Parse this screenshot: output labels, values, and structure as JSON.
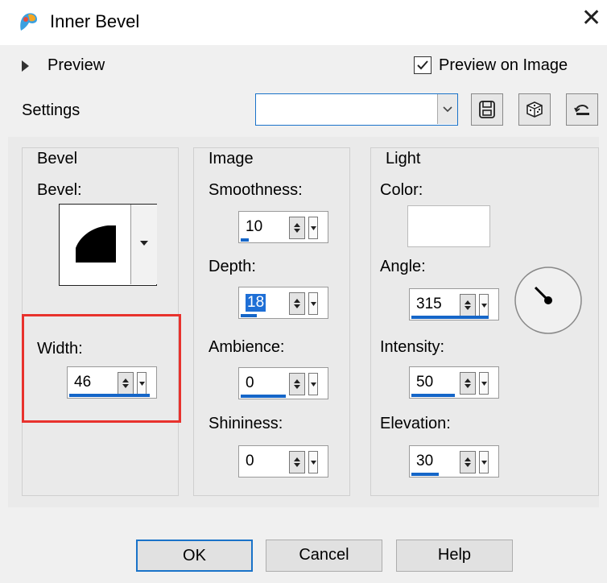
{
  "window": {
    "title": "Inner Bevel"
  },
  "preview": {
    "toggle_label": "Preview",
    "on_image_label": "Preview on Image",
    "on_image_checked": true
  },
  "settings": {
    "label": "Settings",
    "preset_value": ""
  },
  "bevel_group": {
    "title": "Bevel",
    "bevel_label": "Bevel:",
    "width_label": "Width:",
    "width_value": "46"
  },
  "image_group": {
    "title": "Image",
    "smoothness_label": "Smoothness:",
    "smoothness_value": "10",
    "depth_label": "Depth:",
    "depth_value": "18",
    "ambience_label": "Ambience:",
    "ambience_value": "0",
    "shininess_label": "Shininess:",
    "shininess_value": "0"
  },
  "light_group": {
    "title": "Light",
    "color_label": "Color:",
    "color_value": "#ffffff",
    "angle_label": "Angle:",
    "angle_value": "315",
    "intensity_label": "Intensity:",
    "intensity_value": "50",
    "elevation_label": "Elevation:",
    "elevation_value": "30"
  },
  "buttons": {
    "ok": "OK",
    "cancel": "Cancel",
    "help": "Help"
  },
  "colors": {
    "accent": "#1a73c9",
    "highlight_box": "#e8322d"
  }
}
